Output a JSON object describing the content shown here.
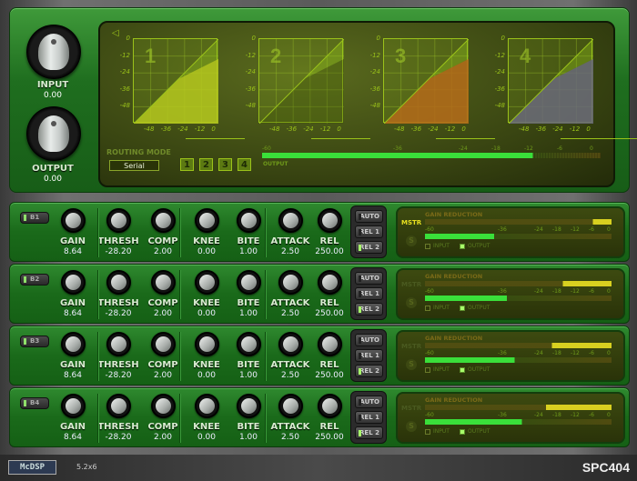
{
  "header": {
    "input": {
      "label": "INPUT",
      "value": "0.00"
    },
    "output": {
      "label": "OUTPUT",
      "value": "0.00"
    }
  },
  "display": {
    "graphs": [
      {
        "number": "1",
        "fill_color": "#b5c81e",
        "threshold_db": -28.2,
        "ratio": 2.0
      },
      {
        "number": "2",
        "fill_color": "none",
        "threshold_db": -28.2,
        "ratio": 2.0
      },
      {
        "number": "3",
        "fill_color": "#b46a1a",
        "threshold_db": -28.2,
        "ratio": 2.0
      },
      {
        "number": "4",
        "fill_color": "#6a6a7a",
        "threshold_db": -28.2,
        "ratio": 2.0
      }
    ],
    "y_ticks": [
      "0",
      "-12",
      "-24",
      "-36",
      "-48"
    ],
    "x_ticks": [
      "-48",
      "-36",
      "-24",
      "-12",
      "0"
    ],
    "routing_mode_label": "ROUTING MODE",
    "routing_mode_value": "Serial",
    "routing_buttons": [
      "1",
      "2",
      "3",
      "4"
    ],
    "output_meter": {
      "label": "OUTPUT",
      "scale": [
        "-60",
        "-36",
        "-24",
        "-18",
        "-12",
        "-6",
        "0"
      ],
      "level_db": -12
    }
  },
  "band_param_labels": [
    "GAIN",
    "THRESH",
    "COMP",
    "KNEE",
    "BITE",
    "ATTACK",
    "REL"
  ],
  "rel_buttons": [
    "AUTO",
    "REL 1",
    "REL 2"
  ],
  "meter_panel": {
    "title": "GAIN REDUCTION",
    "mstr_label": "MSTR",
    "solo_label": "S",
    "scale": [
      "-60",
      "-36",
      "-24",
      "-18",
      "-12",
      "-6",
      "0"
    ],
    "input_label": "INPUT",
    "output_label": "OUTPUT"
  },
  "bands": [
    {
      "name": "B1",
      "values": [
        "8.64",
        "-28.20",
        "2.00",
        "0.00",
        "1.00",
        "2.50",
        "250.00"
      ],
      "active_rel": "REL 2",
      "mstr_active": true,
      "gain_reduction_fraction": 0.1,
      "output_fraction": 0.37
    },
    {
      "name": "B2",
      "values": [
        "8.64",
        "-28.20",
        "2.00",
        "0.00",
        "1.00",
        "2.50",
        "250.00"
      ],
      "active_rel": "REL 2",
      "mstr_active": false,
      "gain_reduction_fraction": 0.26,
      "output_fraction": 0.44
    },
    {
      "name": "B3",
      "values": [
        "8.64",
        "-28.20",
        "2.00",
        "0.00",
        "1.00",
        "2.50",
        "250.00"
      ],
      "active_rel": "REL 2",
      "mstr_active": false,
      "gain_reduction_fraction": 0.32,
      "output_fraction": 0.48
    },
    {
      "name": "B4",
      "values": [
        "8.64",
        "-28.20",
        "2.00",
        "0.00",
        "1.00",
        "2.50",
        "250.00"
      ],
      "active_rel": "REL 2",
      "mstr_active": false,
      "gain_reduction_fraction": 0.35,
      "output_fraction": 0.52
    }
  ],
  "footer": {
    "logo": "McDSP",
    "version": "5.2x6",
    "product": "SPC404"
  }
}
